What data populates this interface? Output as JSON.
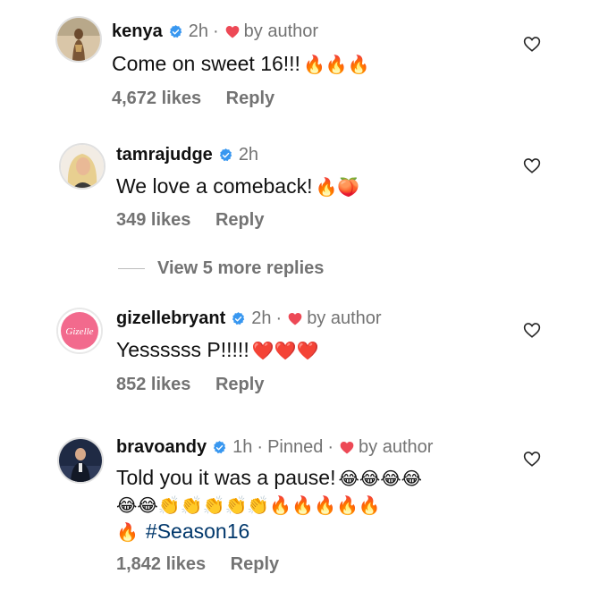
{
  "comments": [
    {
      "username": "kenya",
      "verified": true,
      "time": "2h",
      "pinned": null,
      "liked_by_author": true,
      "by_author_label": "by author",
      "text": "Come on sweet 16!!!",
      "emojis": "🔥🔥🔥",
      "likes": "4,672 likes",
      "reply": "Reply"
    },
    {
      "username": "tamrajudge",
      "verified": true,
      "time": "2h",
      "pinned": null,
      "liked_by_author": false,
      "text": "We love a comeback!",
      "emojis": "🔥🍑",
      "likes": "349 likes",
      "reply": "Reply"
    },
    {
      "username": "gizellebryant",
      "verified": true,
      "time": "2h",
      "pinned": null,
      "liked_by_author": true,
      "by_author_label": "by author",
      "text": "Yessssss P!!!!!",
      "emojis": "❤️❤️❤️",
      "avatar_text": "Gizelle",
      "likes": "852 likes",
      "reply": "Reply"
    },
    {
      "username": "bravoandy",
      "verified": true,
      "time": "1h",
      "pinned": "Pinned",
      "liked_by_author": true,
      "by_author_label": "by author",
      "text": "Told you it was a pause!",
      "emojis_line1": "😂😂😂😂",
      "emojis_line2": "😂😂👏👏👏👏👏🔥🔥🔥🔥🔥",
      "emojis_line3": "🔥",
      "hashtag": "#Season16",
      "likes": "1,842 likes",
      "reply": "Reply"
    }
  ],
  "view_more": "View 5 more replies",
  "colors": {
    "secondary_text": "#737373",
    "verified_blue": "#3897f0",
    "heart_red": "#ed4956",
    "hashtag": "#00376b"
  },
  "icons": {
    "verified": "verified-badge-icon",
    "liked_by_author": "heart-filled-icon",
    "like": "heart-outline-icon"
  }
}
